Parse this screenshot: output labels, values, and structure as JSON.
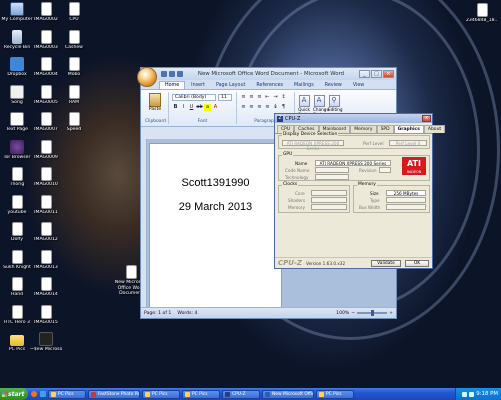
{
  "desktop_icons": [
    {
      "label": "My Computer",
      "glyph": "computer-icon"
    },
    {
      "label": "IMAG0002",
      "glyph": "image-file-icon"
    },
    {
      "label": "CPU",
      "glyph": "image-file-icon"
    },
    {
      "label": "Recycle Bin",
      "glyph": "recycle-bin-icon"
    },
    {
      "label": "IMAG0003",
      "glyph": "image-file-icon"
    },
    {
      "label": "Cashew",
      "glyph": "image-file-icon"
    },
    {
      "label": "Dropbox",
      "glyph": "dropbox-icon"
    },
    {
      "label": "IMAG0004",
      "glyph": "image-file-icon"
    },
    {
      "label": "Mobo",
      "glyph": "image-file-icon"
    },
    {
      "label": "Song",
      "glyph": "audio-file-icon"
    },
    {
      "label": "IMAG0005",
      "glyph": "image-file-icon"
    },
    {
      "label": "RAM",
      "glyph": "image-file-icon"
    },
    {
      "label": "Text Page",
      "glyph": "text-file-icon"
    },
    {
      "label": "IMAG0007",
      "glyph": "image-file-icon"
    },
    {
      "label": "Speed",
      "glyph": "image-file-icon"
    },
    {
      "label": "Tor Browser",
      "glyph": "tor-icon"
    },
    {
      "label": "IMAG0009",
      "glyph": "image-file-icon"
    },
    {
      "label": "Thorig",
      "glyph": "image-file-icon"
    },
    {
      "label": "IMAG0010",
      "glyph": "image-file-icon"
    },
    {
      "label": "youtube",
      "glyph": "image-file-icon"
    },
    {
      "label": "IMAG0011",
      "glyph": "image-file-icon"
    },
    {
      "label": "Dolfy",
      "glyph": "image-file-icon"
    },
    {
      "label": "IMAG0012",
      "glyph": "image-file-icon"
    },
    {
      "label": "Sukh Knight",
      "glyph": "image-file-icon"
    },
    {
      "label": "IMAG0013",
      "glyph": "image-file-icon"
    },
    {
      "label": "Hand",
      "glyph": "image-file-icon"
    },
    {
      "label": "IMAG0014",
      "glyph": "image-file-icon"
    },
    {
      "label": "HTC Hero 3",
      "glyph": "image-file-icon"
    },
    {
      "label": "IMAG0015",
      "glyph": "image-file-icon"
    },
    {
      "label": "PC Pics",
      "glyph": "folder-icon"
    },
    {
      "label": "~$ew Microsoft Office Wor...",
      "glyph": "word-temp-file-icon"
    },
    {
      "label": "New Microsoft Office Word Document",
      "glyph": "word-document-icon"
    },
    {
      "label": "2346848_18...",
      "glyph": "image-file-icon"
    }
  ],
  "word": {
    "title": "New Microsoft Office Word Document - Microsoft Word",
    "tabs": [
      "Home",
      "Insert",
      "Page Layout",
      "References",
      "Mailings",
      "Review",
      "View"
    ],
    "active_tab": "Home",
    "paste_label": "Paste",
    "font_name": "Calibri (Body)",
    "font_size": "11",
    "quick_styles_label": "Quick Styles",
    "change_styles_label": "Change Styles",
    "editing_label": "Editing",
    "group_clipboard": "Clipboard",
    "group_font": "Font",
    "group_paragraph": "Paragraph",
    "group_styles": "Styles",
    "doc_line_1": "Scott1391990",
    "doc_line_2": "29 March 2013",
    "status_page": "Page: 1 of 1",
    "status_words": "Words: 4",
    "zoom": "100%",
    "zoom_fraction": 0.5
  },
  "cpuz": {
    "title": "CPU-Z",
    "tabs": [
      "CPU",
      "Caches",
      "Mainboard",
      "Memory",
      "SPD",
      "Graphics",
      "About"
    ],
    "active_tab": "Graphics",
    "display_selection_label": "Display Device Selection",
    "display_device": "ATI RADEON XPRESS 200 Series",
    "perf_level_label": "Perf Level",
    "perf_level": "Perf Level 0",
    "gpu_label": "GPU",
    "name_label": "Name",
    "name_value": "ATI RADEON XPRESS 200 Series",
    "code_name_label": "Code Name",
    "revision_label": "Revision",
    "technology_label": "Technology",
    "clocks_label": "Clocks",
    "core_label": "Core",
    "shaders_label": "Shaders",
    "memory_clock_label": "Memory",
    "memory_group_label": "Memory",
    "size_label": "Size",
    "size_value": "256 MBytes",
    "type_label": "Type",
    "bus_width_label": "Bus Width",
    "logo_text": "ATI",
    "logo_sub": "RADEON",
    "brand": "CPU-Z",
    "version": "Version 1.63.0.x32",
    "validate_label": "Validate",
    "ok_label": "OK"
  },
  "taskbar": {
    "start_label": "start",
    "buttons": [
      {
        "label": "PC Pics"
      },
      {
        "label": "FastStone Photo Re..."
      },
      {
        "label": "PC Pics"
      },
      {
        "label": "PC Pics"
      },
      {
        "label": "CPU-Z"
      },
      {
        "label": "New Microsoft Offic..."
      },
      {
        "label": "PC Pics"
      }
    ],
    "clock": "9:18 PM"
  },
  "colors": {
    "taskbar_blue": "#2456d0",
    "start_green": "#2e8a2b",
    "ati_red": "#d71920"
  }
}
